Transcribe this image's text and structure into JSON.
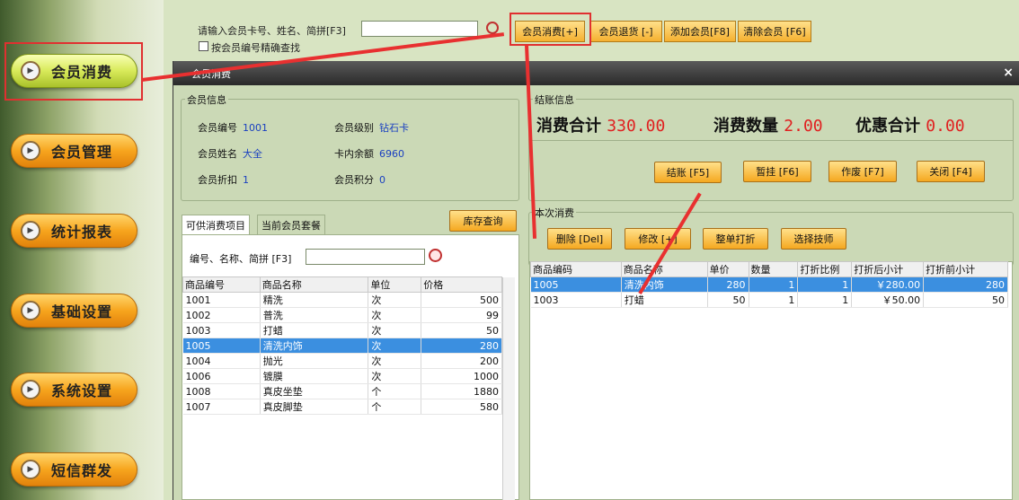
{
  "sidebar": {
    "items": [
      {
        "label": "会员消费",
        "active": true
      },
      {
        "label": "会员管理"
      },
      {
        "label": "统计报表"
      },
      {
        "label": "基础设置"
      },
      {
        "label": "系统设置"
      },
      {
        "label": "短信群发"
      }
    ]
  },
  "top": {
    "search_label": "请输入会员卡号、姓名、简拼[F3]",
    "checkbox_label": "按会员编号精确查找",
    "buttons": [
      "会员消费[+]",
      "会员退货 [-]",
      "添加会员[F8]",
      "清除会员 [F6]"
    ]
  },
  "dialog": {
    "title": "会员消费",
    "close": "×",
    "member_info": {
      "legend": "会员信息",
      "no_label": "会员编号",
      "no": "1001",
      "level_label": "会员级别",
      "level": "钻石卡",
      "name_label": "会员姓名",
      "name": "大全",
      "balance_label": "卡内余额",
      "balance": "6960",
      "discount_label": "会员折扣",
      "discount": "1",
      "points_label": "会员积分",
      "points": "0"
    },
    "checkout": {
      "legend": "结账信息",
      "total_label": "消费合计",
      "total": "330.00",
      "qty_label": "消费数量",
      "qty": "2.00",
      "discount_label": "优惠合计",
      "discount": "0.00",
      "buttons": [
        "结账 [F5]",
        "暂挂 [F6]",
        "作废 [F7]",
        "关闭 [F4]"
      ]
    },
    "tabs": [
      "可供消费项目",
      "当前会员套餐"
    ],
    "stock_button": "库存查询",
    "item_search_label": "编号、名称、简拼 [F3]",
    "items_table": {
      "headers": [
        "商品编号",
        "商品名称",
        "单位",
        "价格"
      ],
      "rows": [
        [
          "1001",
          "精洗",
          "次",
          "500"
        ],
        [
          "1002",
          "普洗",
          "次",
          "99"
        ],
        [
          "1003",
          "打蜡",
          "次",
          "50"
        ],
        [
          "1005",
          "清洗内饰",
          "次",
          "280"
        ],
        [
          "1004",
          "抛光",
          "次",
          "200"
        ],
        [
          "1006",
          "镀膜",
          "次",
          "1000"
        ],
        [
          "1008",
          "真皮坐垫",
          "个",
          "1880"
        ],
        [
          "1007",
          "真皮脚垫",
          "个",
          "580"
        ]
      ],
      "selected": 3
    },
    "consume": {
      "legend": "本次消费",
      "buttons": [
        "删除 [Del]",
        "修改 [+]",
        "整单打折",
        "选择技师"
      ],
      "headers": [
        "商品编码",
        "商品名称",
        "单价",
        "数量",
        "打折比例",
        "打折后小计",
        "打折前小计"
      ],
      "rows": [
        [
          "1005",
          "清洗内饰",
          "280",
          "1",
          "1",
          "￥280.00",
          "280"
        ],
        [
          "1003",
          "打蜡",
          "50",
          "1",
          "1",
          "￥50.00",
          "50"
        ]
      ],
      "selected": 0
    }
  }
}
